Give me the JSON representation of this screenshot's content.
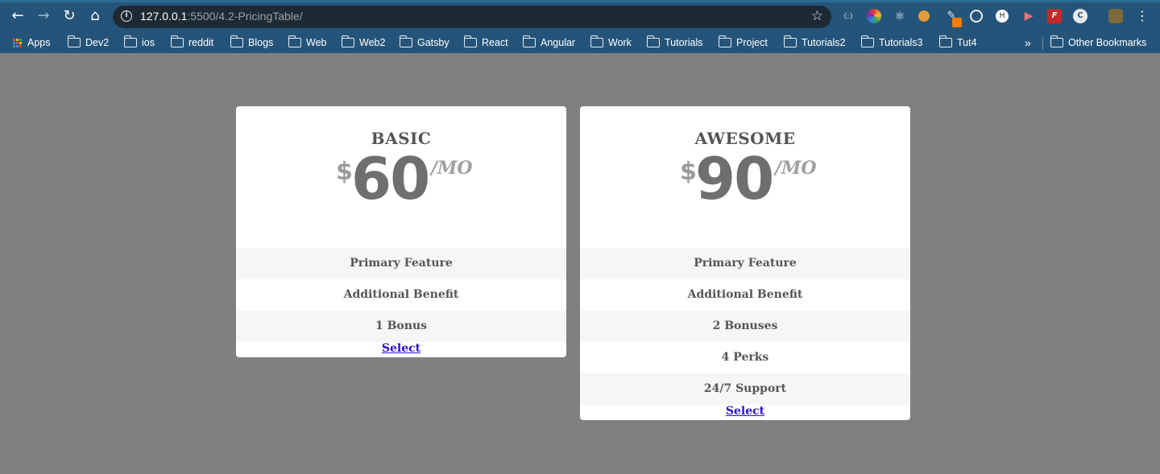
{
  "browser": {
    "url_host": "127.0.0.1",
    "url_path": ":5500/4.2-PricingTable/",
    "bookmarks": [
      "Apps",
      "Dev2",
      "ios",
      "reddit",
      "Blogs",
      "Web",
      "Web2",
      "Gatsby",
      "React",
      "Angular",
      "Work",
      "Tutorials",
      "Project",
      "Tutorials2",
      "Tutorials3",
      "Tut4"
    ],
    "overflow_label": "»",
    "other_bookmarks": "Other Bookmarks"
  },
  "plans": [
    {
      "name": "BASIC",
      "currency": "$",
      "amount": "60",
      "period": "/MO",
      "features": [
        "Primary Feature",
        "Additional Benefit",
        "1 Bonus"
      ],
      "cta": "Select"
    },
    {
      "name": "AWESOME",
      "currency": "$",
      "amount": "90",
      "period": "/MO",
      "features": [
        "Primary Feature",
        "Additional Benefit",
        "2 Bonuses",
        "4 Perks",
        "24/7 Support"
      ],
      "cta": "Select"
    }
  ],
  "colors": {
    "page_background": "#808080",
    "card_background": "#ffffff",
    "link": "#2a12c9",
    "chrome": "#25547a"
  }
}
